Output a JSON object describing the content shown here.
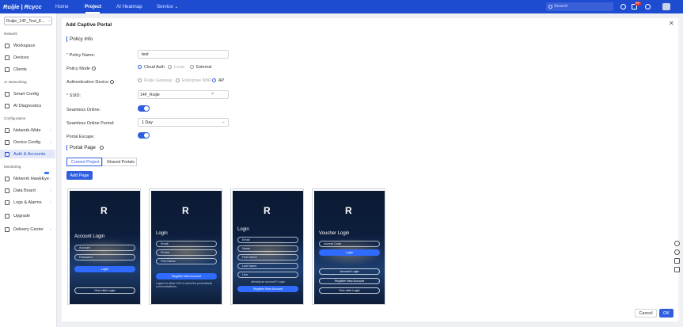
{
  "topbar": {
    "logo": "Ruijie | Rcycc",
    "nav": [
      "Home",
      "Project",
      "AI Heatmap",
      "Service"
    ],
    "active_nav": "Project",
    "search_placeholder": "Search",
    "notification_count": "99+",
    "accent": "#1e4cd0"
  },
  "sidebar": {
    "project_select": "Ruijie_14F_Test_E...",
    "sections": {
      "network": "Network",
      "ai": "AI Networking",
      "config": "Configuration",
      "monitoring": "Monitoring"
    },
    "items": [
      {
        "label": "Workspace",
        "icon": "workspace-icon",
        "arrow": false
      },
      {
        "label": "Devices",
        "icon": "devices-icon",
        "arrow": false
      },
      {
        "label": "Clients",
        "icon": "clients-icon",
        "arrow": false
      },
      {
        "label": "Smart Config",
        "icon": "smart-config-icon",
        "arrow": false
      },
      {
        "label": "AI Diagnostics",
        "icon": "ai-diagnostics-icon",
        "arrow": false
      },
      {
        "label": "Network-Wide",
        "icon": "network-wide-icon",
        "arrow": true
      },
      {
        "label": "Device Config",
        "icon": "device-config-icon",
        "arrow": true
      },
      {
        "label": "Auth & Accounts",
        "icon": "auth-icon",
        "arrow": true
      },
      {
        "label": "Network HawkEye",
        "icon": "hawkeye-icon",
        "arrow": true
      },
      {
        "label": "Data Board",
        "icon": "data-board-icon",
        "arrow": true
      },
      {
        "label": "Logs & Alarms",
        "icon": "logs-icon",
        "arrow": true
      },
      {
        "label": "Upgrade",
        "icon": "upgrade-icon",
        "arrow": false
      },
      {
        "label": "Delivery Center",
        "icon": "delivery-icon",
        "arrow": true
      }
    ],
    "active_item": "Auth & Accounts"
  },
  "panel": {
    "title": "Add Captive Portal",
    "policy_info": "Policy Info",
    "fields": {
      "policy_name_label": "Policy Name",
      "policy_name_value": "test",
      "policy_mode_label": "Policy Mode",
      "policy_mode_options": [
        "Cloud Auth",
        "Local",
        "External"
      ],
      "policy_mode_selected": "Cloud Auth",
      "auth_device_label": "Authentication Device",
      "auth_device_options": [
        "Ruijie Gateway",
        "Enterprise NBR",
        "AP"
      ],
      "auth_device_selected": "AP",
      "ssid_label": "SSID",
      "ssid_value": "14F_Ruijie",
      "seamless_online_label": "Seamless Online",
      "seamless_online_on": true,
      "seamless_period_label": "Seamless Online Period",
      "seamless_period_value": "1 Day",
      "portal_escape_label": "Portal Escape",
      "portal_escape_on": true
    },
    "portal_page": "Portal Page",
    "tabs": [
      "Current Project",
      "Shared Portals"
    ],
    "active_tab": "Current Project",
    "add_page": "Add Page",
    "cancel": "Cancel",
    "ok": "OK"
  },
  "portals": [
    {
      "title": "Account Login",
      "fields": [
        "Account",
        "Password"
      ],
      "primary": "Login",
      "secondary": [
        "One-click Login"
      ],
      "note": ""
    },
    {
      "title": "Login",
      "fields": [
        "Email",
        "Phone",
        "First Name"
      ],
      "primary": "Register New Account",
      "secondary": [],
      "note": "I agree to allow XXX to send the promotional communications."
    },
    {
      "title": "Login",
      "fields": [
        "Email",
        "Name",
        "First Name",
        "Last Name",
        "Line"
      ],
      "primary": "Register New Account",
      "secondary": [],
      "note": "Already an account? Login"
    },
    {
      "title": "Voucher Login",
      "fields": [
        "Access Code"
      ],
      "primary": "Login",
      "secondary": [
        "Account Login",
        "Register New Account",
        "One-click Login"
      ],
      "note": ""
    }
  ]
}
